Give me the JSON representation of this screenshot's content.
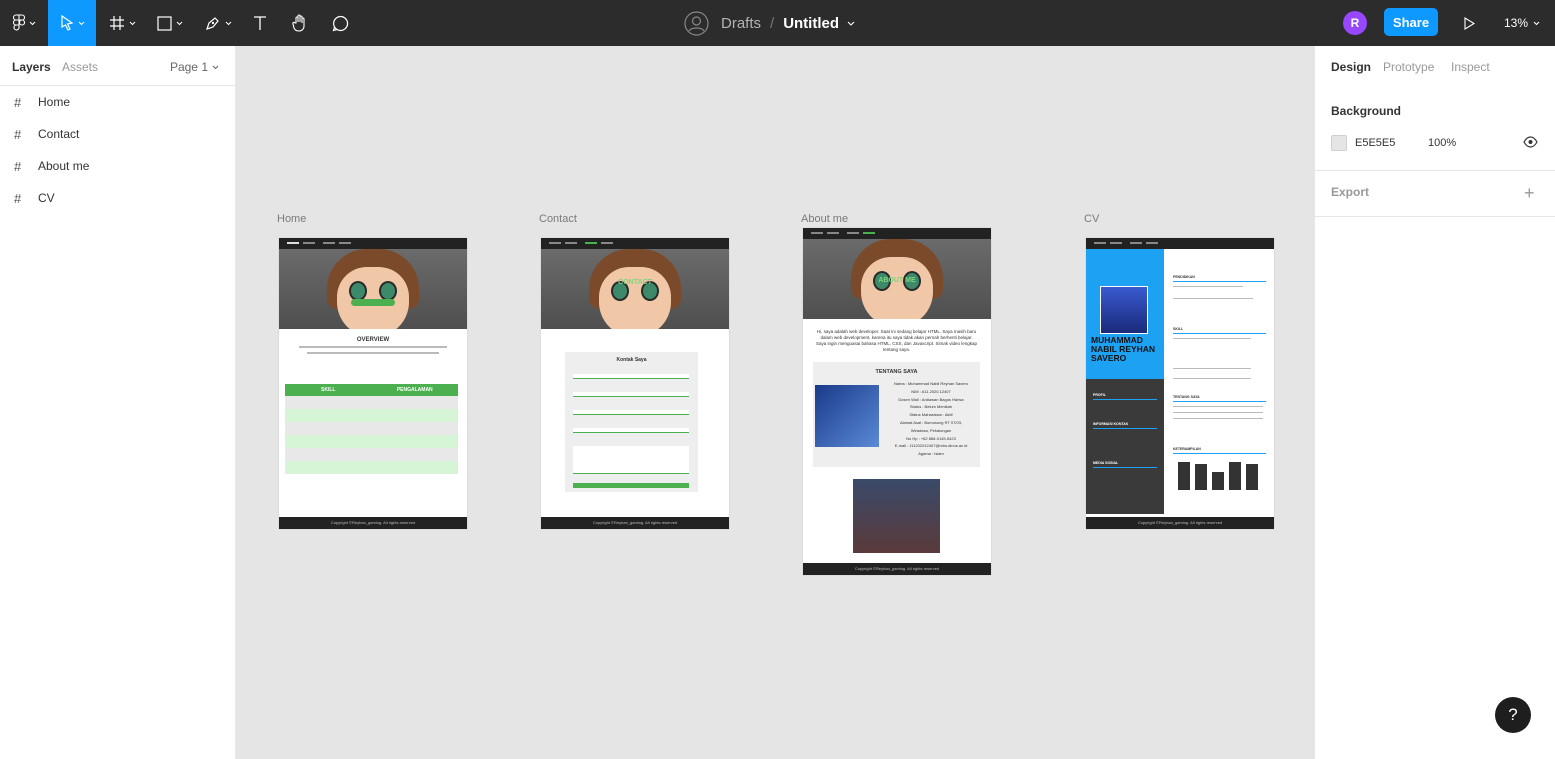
{
  "toolbar": {
    "file_location": "Drafts",
    "separator": "/",
    "file_name": "Untitled",
    "user_initial": "R",
    "share_label": "Share",
    "zoom_level": "13%",
    "colors": {
      "bar": "#2c2c2c",
      "accent": "#0d99ff",
      "avatar": "#9747ff"
    },
    "tools": [
      "main-menu-icon",
      "move-icon",
      "frame-icon",
      "shape-icon",
      "pen-icon",
      "text-icon",
      "hand-icon",
      "comment-icon"
    ]
  },
  "left_panel": {
    "tabs": [
      {
        "label": "Layers"
      },
      {
        "label": "Assets"
      }
    ],
    "page_selector": "Page 1",
    "layers": [
      {
        "label": "Home"
      },
      {
        "label": "Contact"
      },
      {
        "label": "About me"
      },
      {
        "label": "CV"
      }
    ]
  },
  "right_panel": {
    "tabs": [
      {
        "label": "Design"
      },
      {
        "label": "Prototype"
      },
      {
        "label": "Inspect"
      }
    ],
    "background": {
      "title": "Background",
      "hex": "E5E5E5",
      "opacity": "100%"
    },
    "export": {
      "title": "Export"
    }
  },
  "canvas": {
    "background": "#e5e5e5",
    "frames": {
      "home": {
        "label": "Home",
        "overview_title": "OVERVIEW",
        "table_headers": [
          "SKILL",
          "PENGALAMAN"
        ],
        "footer": "Copyright ©Reyhan_gaming. All rights reserved"
      },
      "contact": {
        "label": "Contact",
        "hero_text": "CONTACT",
        "form_title": "Kontak Saya",
        "submit": "Submit",
        "footer": "Copyright ©Reyhan_gaming. All rights reserved"
      },
      "about": {
        "label": "About me",
        "hero_text": "ABOUT ME",
        "intro": "Hi, saya adalah web developer. Saat ini sedang belajar HTML. Saya masih baru dalam web development, karena itu saya tidak akan pernah berhenti belajar. Saya ingin menguasai bahasa HTML, CSS, dan Javascript. Simak video lengkap tentang saya.",
        "card_title": "TENTANG SAYA",
        "info_lines": [
          "Nama : Muhammad Nabil Reyhan Savero",
          "NIM : A11.2020.12407",
          "Dosen Wali : Ardiawan Bagus Harisa",
          "Status : Belum Menikah",
          "Status Mahasiswa : Aktif",
          "Alamat Asal : Bomosong RT 07/03,",
          "Wiradesa, Pekalongan",
          "No Hp : +62 888-0145-5423",
          "E-mail : 111202012407@mhs.dinus.ac.id",
          "Agama : Islam"
        ],
        "footer": "Copyright ©Reyhan_gaming. All rights reserved"
      },
      "cv": {
        "label": "CV",
        "name": "MUHAMMAD NABIL REYHAN SAVERO",
        "sections_left": [
          "PROFIL",
          "INFORMASI KONTAK",
          "MEDIA SOSIAL"
        ],
        "sections_right": [
          "PENDIDIKAN",
          "SKILL",
          "TENTANG SAYA",
          "KETERAMPILAN"
        ],
        "chart_levels": [
          0.85,
          0.8,
          0.55,
          0.85,
          0.8
        ],
        "footer": "Copyright ©Reyhan_gaming. All rights reserved"
      }
    }
  },
  "help": {
    "label": "?"
  }
}
